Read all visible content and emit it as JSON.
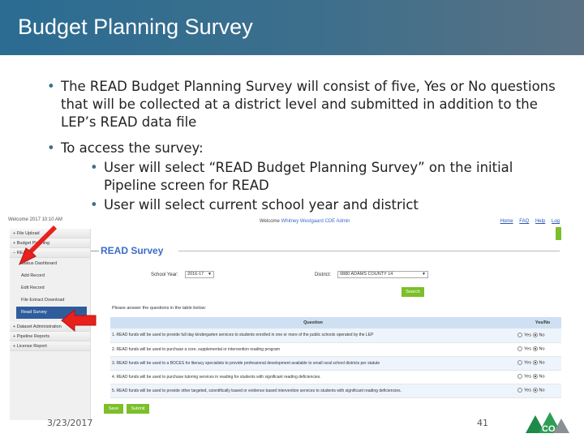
{
  "slide": {
    "title": "Budget Planning Survey",
    "bullets": [
      "The READ Budget Planning Survey will consist of five, Yes or No questions that will be collected at a district level and submitted in addition to the LEP’s READ data file",
      "To access the survey:"
    ],
    "sub_bullets": [
      "User will select “READ Budget Planning Survey” on the initial Pipeline screen for READ",
      "User will select current school year and district"
    ],
    "footer_date": "3/23/2017",
    "page_number": "41",
    "logo_text": "CO"
  },
  "screenshot": {
    "login_info": "Welcome 2017 10:10 AM",
    "welcome_prefix": "Welcome",
    "welcome_user": "Whitney Westgaard CDE Admin",
    "top_links": [
      "Home",
      "FAQ",
      "Help",
      "Log"
    ],
    "sidebar": {
      "items_top": [
        "File Upload",
        "Budget Planning",
        "READ"
      ],
      "read_subitems": [
        "Status Dashboard",
        "Add Record",
        "Edit Record",
        "File Extract Download",
        "Read Survey"
      ],
      "items_bottom": [
        "Dataset Administration",
        "Pipeline Reports",
        "License Report"
      ]
    },
    "panel_title": "READ Survey",
    "school_year_label": "School Year:",
    "school_year_value": "2016-17",
    "district_label": "District:",
    "district_value": "0880 ADAMS COUNTY 14",
    "search_label": "Search",
    "instructions": "Please answer the questions in the table below:",
    "table_headers": {
      "question": "Question",
      "yesno": "Yes/No"
    },
    "questions": [
      "1. READ funds will be used to provide full day kindergarten services to students enrolled in one or more of the public schools operated by the LEP",
      "2. READ funds will be used to purchase a core, supplemental or intervention reading program",
      "3. READ funds will be used to a BOCES for literacy specialists to provide professional development available to small rural school districts per statute",
      "4. READ funds will be used to purchase tutoring services in reading for students with significant reading deficiencies.",
      "5. READ funds will be used to provide other targeted, scientifically based or evidence based intervention services to students with significant reading deficiencies."
    ],
    "yes_label": "Yes",
    "no_label": "No",
    "save_label": "Save",
    "submit_label": "Submit"
  },
  "colors": {
    "title_bar": "#3d6f8c",
    "accent_green": "#7cbf2a",
    "link_blue": "#3b6cc9",
    "arrow_red": "#e8211c"
  }
}
